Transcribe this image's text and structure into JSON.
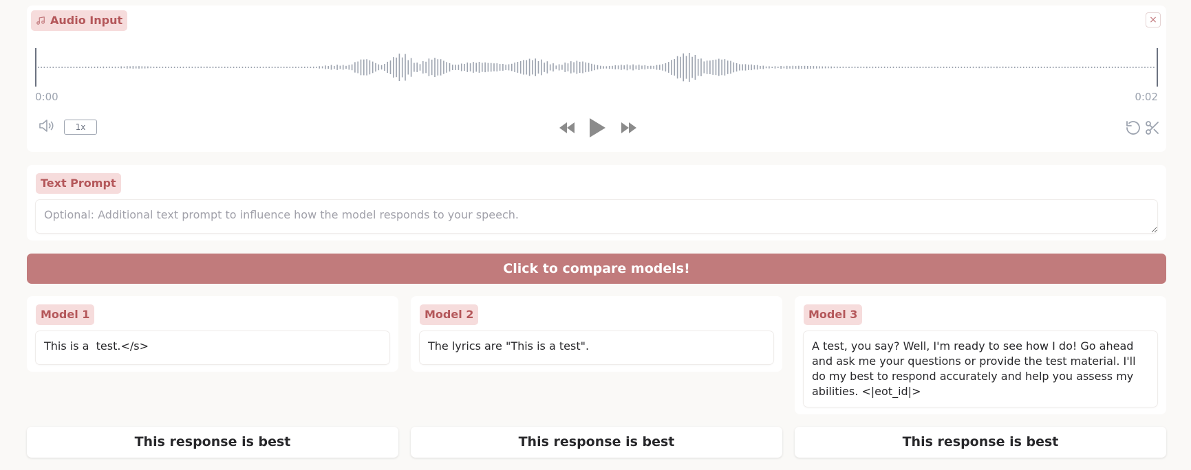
{
  "audio": {
    "label": "Audio Input",
    "close_symbol": "×",
    "time_start": "0:00",
    "time_end": "0:02",
    "speed": "1x",
    "icons": [
      "music-note-icon",
      "volume-icon",
      "rewind-icon",
      "play-icon",
      "fast-forward-icon",
      "undo-icon",
      "scissors-icon",
      "close-icon"
    ]
  },
  "prompt": {
    "label": "Text Prompt",
    "placeholder": "Optional: Additional text prompt to influence how the model responds to your speech.",
    "value": ""
  },
  "compare_button": "Click to compare models!",
  "models": [
    {
      "label": "Model 1",
      "response": "This is a  test.</s>",
      "best_label": "This response is best"
    },
    {
      "label": "Model 2",
      "response": "The lyrics are \"This is a test\".",
      "best_label": "This response is best"
    },
    {
      "label": "Model 3",
      "response": "A test, you say? Well, I'm ready to see how I do! Go ahead and ask me your questions or provide the test material. I'll do my best to respond accurately and help you assess my abilities. <|eot_id|>",
      "best_label": "This response is best"
    }
  ],
  "colors": {
    "accent": "#c17b7c",
    "chip_bg": "#f6dcdc",
    "chip_text": "#b4575a",
    "waveform": "#9ca3af"
  }
}
